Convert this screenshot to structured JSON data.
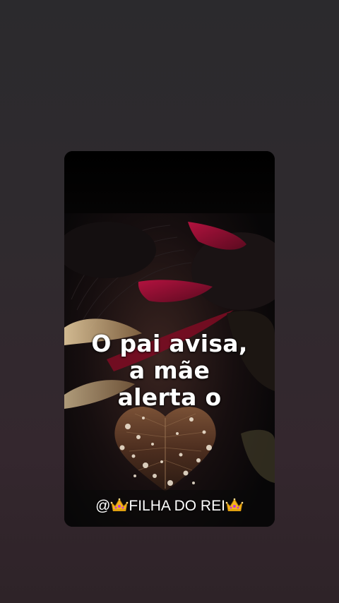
{
  "story": {
    "lines": [
      "O pai avisa,",
      "a mãe",
      "alerta o"
    ],
    "watermark": {
      "prefix": "@",
      "name": "FILHA DO REI",
      "icon": "crown-icon"
    }
  }
}
